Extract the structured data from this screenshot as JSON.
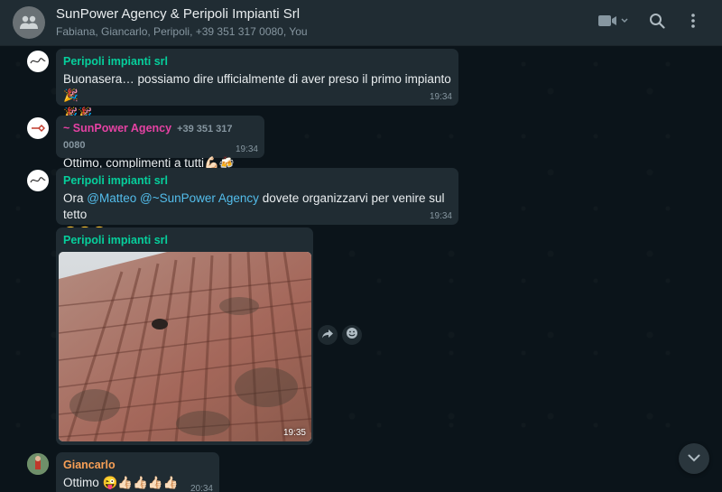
{
  "header": {
    "title": "SunPower Agency & Peripoli Impianti Srl",
    "subtitle": "Fabiana, Giancarlo, Peripoli, +39 351 317 0080, You",
    "icons": [
      "group-avatar-icon",
      "video-call-icon",
      "search-icon",
      "menu-icon"
    ]
  },
  "messages": [
    {
      "sender": "Peripoli impianti srl",
      "text": "Buonasera… possiamo dire ufficialmente di aver preso il primo impianto 🎉",
      "text_line2": "🎉🎉",
      "time": "19:34"
    },
    {
      "sender": "~ SunPower Agency",
      "phone": "+39 351 317 0080",
      "text": "Ottimo, complimenti a tutti💪🏻🍻",
      "time": "19:34"
    },
    {
      "sender": "Peripoli impianti srl",
      "text_pre": "Ora ",
      "mention1": "@Matteo",
      "mention2": "@~SunPower Agency",
      "text_post": " dovete organizzarvi per venire sul tetto",
      "text_line2": "😂😂😂",
      "time": "19:34"
    },
    {
      "sender": "Peripoli impianti srl",
      "image_alt": "roof-tiles-photo",
      "time": "19:35"
    },
    {
      "sender": "Giancarlo",
      "text": "Ottimo 😜👍🏻👍🏻👍🏻👍🏻",
      "time": "20:34"
    }
  ],
  "colors": {
    "header_bg": "#202c33",
    "chat_bg": "#0b141a",
    "bubble_bg": "#202c33",
    "sender_green": "#06cf9c",
    "sender_pink": "#e542a3",
    "sender_orange": "#f8a056",
    "mention": "#53bdeb"
  }
}
